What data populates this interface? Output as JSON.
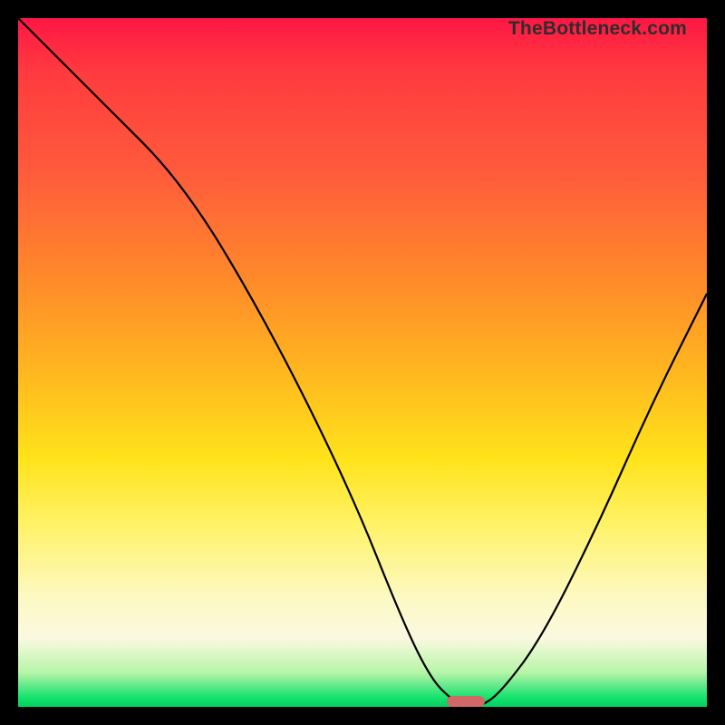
{
  "watermark": "TheBottleneck.com",
  "chart_data": {
    "type": "line",
    "title": "",
    "xlabel": "",
    "ylabel": "",
    "xlim": [
      0,
      100
    ],
    "ylim": [
      0,
      100
    ],
    "series": [
      {
        "name": "bottleneck-curve",
        "x": [
          0,
          12,
          24,
          36,
          48,
          56,
          60,
          63,
          65,
          67,
          70,
          76,
          84,
          92,
          100
        ],
        "values": [
          100,
          88,
          76,
          56,
          32,
          12,
          4,
          1,
          0,
          0,
          2,
          10,
          26,
          44,
          60
        ]
      }
    ],
    "annotations": [
      {
        "name": "optimal-marker",
        "x": 65,
        "y": 0,
        "kind": "pill",
        "color": "#d06868"
      }
    ],
    "background_gradient": {
      "top": "#ff1744",
      "mid_high": "#ff8a2a",
      "mid": "#ffe31a",
      "mid_low": "#fdf9c2",
      "bottom": "#00d060"
    }
  },
  "marker": {
    "width_pct": 5.5,
    "height_pct": 1.6
  }
}
